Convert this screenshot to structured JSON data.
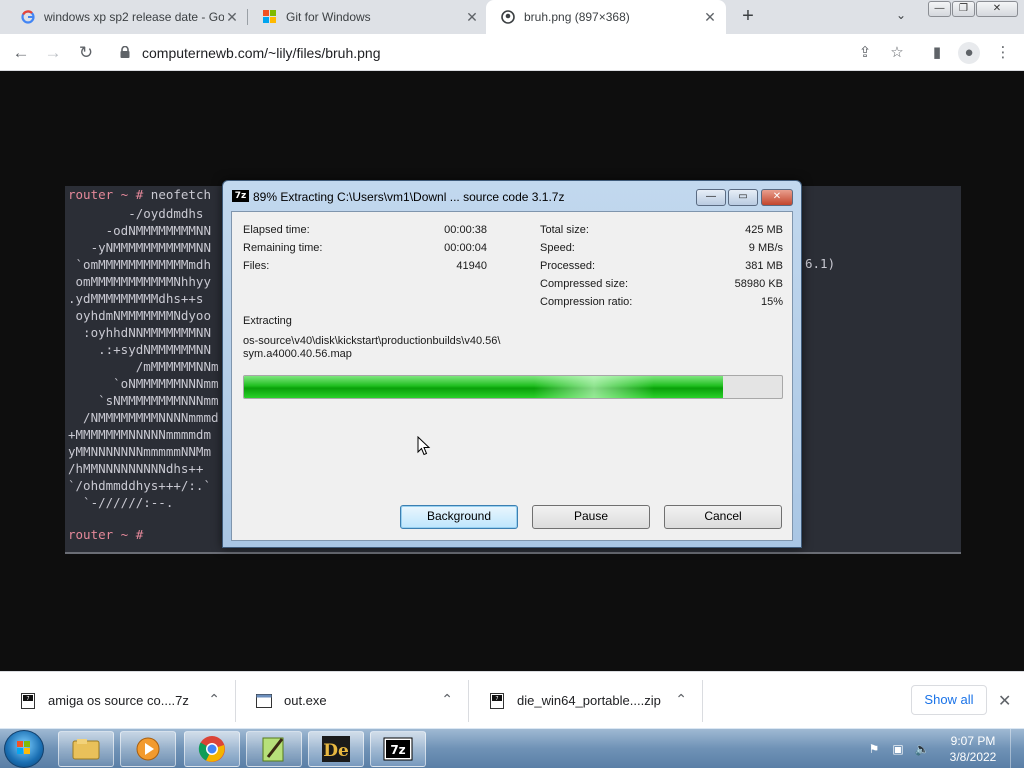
{
  "browser": {
    "tabs": [
      {
        "title": "windows xp sp2 release date - Go",
        "favicon": "google-icon",
        "active": false
      },
      {
        "title": "Git for Windows",
        "favicon": "git-icon",
        "active": false
      },
      {
        "title": "bruh.png (897×368)",
        "favicon": "image-icon",
        "active": true
      }
    ],
    "new_tab": "+",
    "tab_menu": "⌄",
    "url": "computernewb.com/~lily/files/bruh.png"
  },
  "terminal": {
    "prompt_top": "router ~ # ",
    "command": "neofetch",
    "art_lines": [
      "        -/oyddmdhs",
      "     -odNMMMMMMMMNN",
      "   -yNMMMMMMMMMMMNN",
      " `omMMMMMMMMMMMMmdh",
      " omMMMMMMMMMMMNhhyy",
      ".ydMMMMMMMMMdhs++s",
      " oyhdmNMMMMMMMNdyoo",
      "  :oyhhdNNMMMMMMMNN",
      "    .:+sydNMMMMMMNN",
      "         /mMMMMMMNNm",
      "      `oNMMMMMMNNNmm",
      "    `sNMMMMMMMMNNNmm",
      "  /NMMMMMMMMNNNNmmmd",
      "+MMMMMMMNNNNNmmmmdm",
      "yMMNNNNNNNmmmmmNNMm",
      "/hMMNNNNNNNNNdhs++",
      "`/ohdmmddhys+++/:.`",
      "  `-//////:--."
    ],
    "side_text": "6.1)",
    "prompt_bottom": "router ~ #"
  },
  "dialog": {
    "icon": "7z",
    "title": "89% Extracting C:\\Users\\vm1\\Downl ... source code 3.1.7z",
    "window_buttons": {
      "minimize": "—",
      "maximize": "▭",
      "close": "✕"
    },
    "stats_left": [
      {
        "label": "Elapsed time:",
        "value": "00:00:38"
      },
      {
        "label": "Remaining time:",
        "value": "00:00:04"
      },
      {
        "label": "Files:",
        "value": "41940"
      }
    ],
    "stats_right": [
      {
        "label": "Total size:",
        "value": "425 MB"
      },
      {
        "label": "Speed:",
        "value": "9 MB/s"
      },
      {
        "label": "Processed:",
        "value": "381 MB"
      },
      {
        "label": "Compressed size:",
        "value": "58980 KB"
      },
      {
        "label": "Compression ratio:",
        "value": "15%"
      }
    ],
    "operation": "Extracting",
    "current_file_line1": "os-source\\v40\\disk\\kickstart\\productionbuilds\\v40.56\\",
    "current_file_line2": "sym.a4000.40.56.map",
    "progress_percent": 89,
    "buttons": {
      "background": "Background",
      "pause": "Pause",
      "cancel": "Cancel"
    }
  },
  "downloads": {
    "items": [
      {
        "name": "amiga os source co....7z",
        "icon": "archive-file-icon"
      },
      {
        "name": "out.exe",
        "icon": "exe-file-icon"
      },
      {
        "name": "die_win64_portable....zip",
        "icon": "archive-file-icon"
      }
    ],
    "show_all": "Show all",
    "close": "✕"
  },
  "taskbar": {
    "apps": [
      "windows-explorer",
      "windows-media-player",
      "google-chrome",
      "notepad-plus-plus",
      "detect-it-easy",
      "7-zip"
    ],
    "clock_time": "9:07 PM",
    "clock_date": "3/8/2022"
  },
  "colors": {
    "progress": "#1fbe1f",
    "link": "#1a73e8",
    "terminal_bg": "#2b2e36",
    "prompt": "#e5889a"
  }
}
